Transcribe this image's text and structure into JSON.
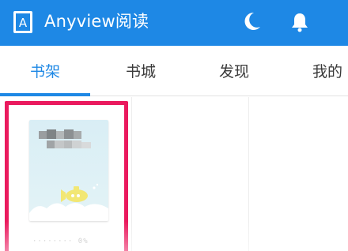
{
  "app": {
    "title": "Anyview阅读",
    "logo_letter": "A",
    "brand_color": "#1e88e5",
    "icons": [
      "moon-icon",
      "bell-icon"
    ]
  },
  "tabs": [
    {
      "label": "书架",
      "active": true
    },
    {
      "label": "书城",
      "active": false
    },
    {
      "label": "发现",
      "active": false
    },
    {
      "label": "我的",
      "active": false
    }
  ],
  "shelf": {
    "books": [
      {
        "progress": "0%",
        "highlight_color": "#ea1a5e"
      }
    ]
  }
}
